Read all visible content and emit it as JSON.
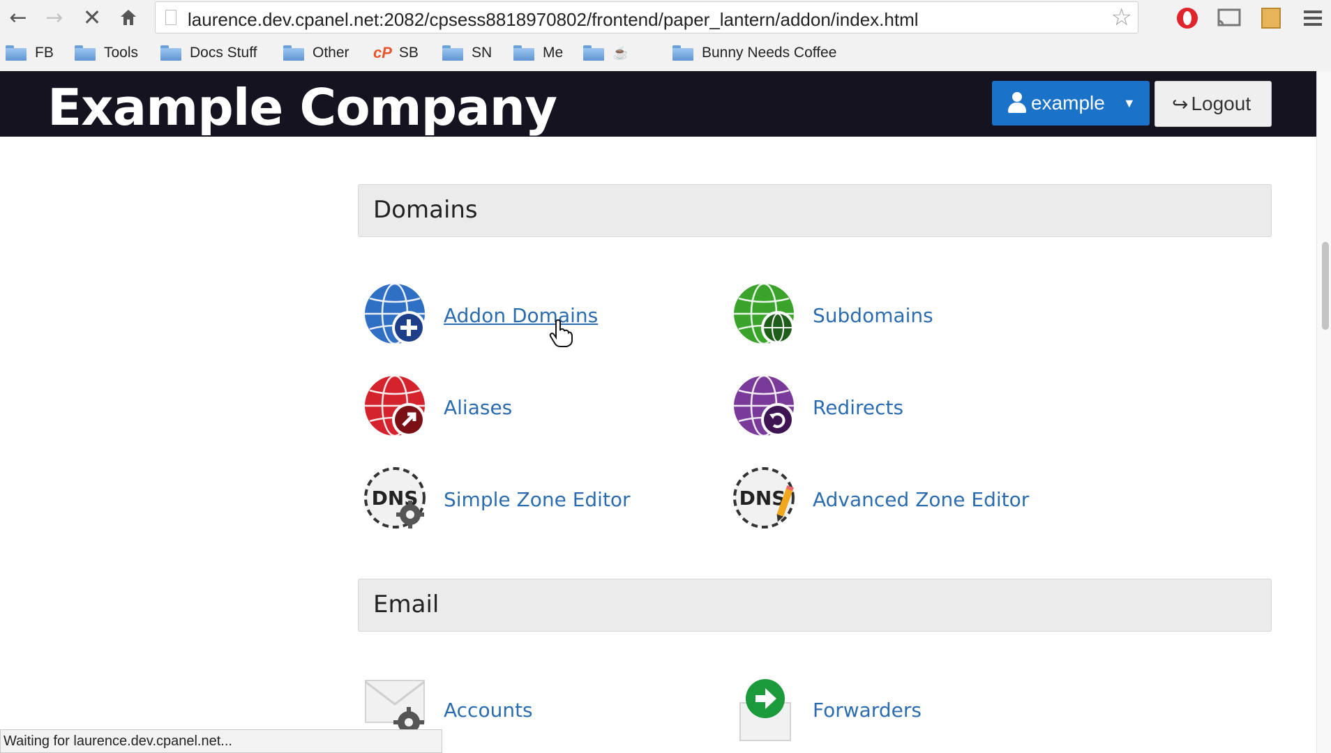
{
  "browser": {
    "url": "laurence.dev.cpanel.net:2082/cpsess8818970802/frontend/paper_lantern/addon/index.html",
    "nav_icons": [
      "back-arrow-icon",
      "forward-arrow-icon",
      "stop-icon",
      "home-icon"
    ],
    "bookmarks": [
      {
        "label": "FB",
        "icon": "folder-icon"
      },
      {
        "label": "Tools",
        "icon": "folder-icon"
      },
      {
        "label": "Docs Stuff",
        "icon": "folder-icon"
      },
      {
        "label": "Other",
        "icon": "folder-icon"
      },
      {
        "label": "SB",
        "icon": "cpanel-icon"
      },
      {
        "label": "SN",
        "icon": "folder-icon"
      },
      {
        "label": "Me",
        "icon": "folder-icon"
      },
      {
        "label": "",
        "icon": "folder-icon"
      },
      {
        "label": "Bunny Needs Coffee",
        "icon": "folder-icon"
      }
    ],
    "status_text": "Waiting for laurence.dev.cpanel.net..."
  },
  "header": {
    "company": "Example Company",
    "user_label": "example",
    "logout_label": "Logout"
  },
  "sections": [
    {
      "title": "Domains",
      "items": [
        {
          "label": "Addon Domains",
          "icon": "globe-plus-icon",
          "color": "#2f6fc4"
        },
        {
          "label": "Subdomains",
          "icon": "globe-sub-icon",
          "color": "#3aa32a"
        },
        {
          "label": "Aliases",
          "icon": "globe-arrow-icon",
          "color": "#d5232e"
        },
        {
          "label": "Redirects",
          "icon": "globe-redirect-icon",
          "color": "#7a3a9a"
        },
        {
          "label": "Simple Zone Editor",
          "icon": "dns-gear-icon",
          "color": "#333333"
        },
        {
          "label": "Advanced Zone Editor",
          "icon": "dns-pencil-icon",
          "color": "#333333"
        }
      ]
    },
    {
      "title": "Email",
      "items": [
        {
          "label": "Accounts",
          "icon": "envelope-gear-icon",
          "color": "#666666"
        },
        {
          "label": "Forwarders",
          "icon": "envelope-forward-icon",
          "color": "#1a9a3a"
        }
      ]
    }
  ],
  "colors": {
    "header_bg": "#15131f",
    "primary_button": "#1b72c9",
    "link": "#2b6cb0",
    "section_bg": "#ebebeb"
  }
}
